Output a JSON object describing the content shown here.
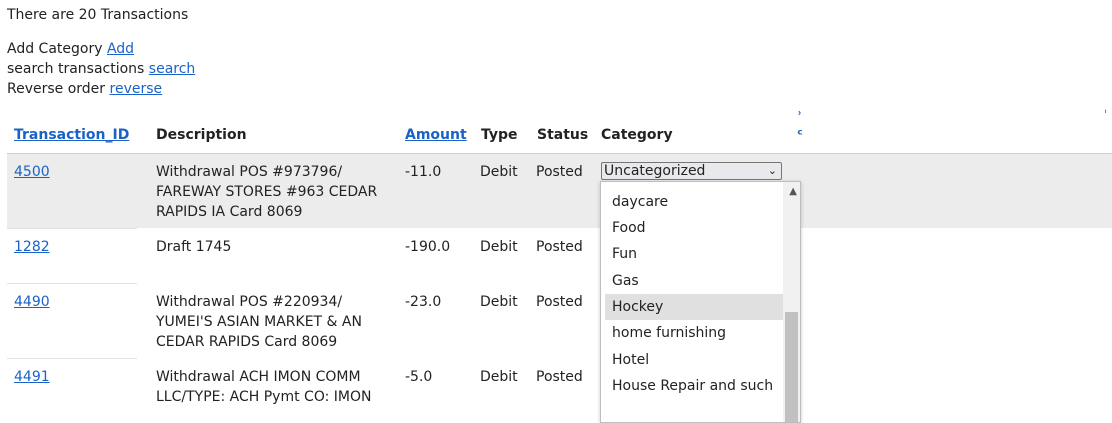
{
  "summary": "There are 20 Transactions",
  "actions": [
    {
      "label": "Add Category",
      "link": "Add"
    },
    {
      "label": "search transactions",
      "link": "search"
    },
    {
      "label": "Reverse order",
      "link": "reverse"
    }
  ],
  "columns": {
    "id": "Transaction_ID",
    "description": "Description",
    "amount": "Amount",
    "type": "Type",
    "status": "Status",
    "category": "Category"
  },
  "rows": [
    {
      "id": "4500",
      "desc1": "Withdrawal POS #973796/",
      "desc2": "FAREWAY STORES #963 CEDAR",
      "desc3": "RAPIDS IA Card 8069",
      "amount": "-11.0",
      "type": "Debit",
      "status": "Posted"
    },
    {
      "id": "1282",
      "desc1": "Draft 1745",
      "desc2": "",
      "desc3": "",
      "amount": "-190.0",
      "type": "Debit",
      "status": "Posted"
    },
    {
      "id": "4490",
      "desc1": "Withdrawal POS #220934/",
      "desc2": "YUMEI'S ASIAN MARKET & AN",
      "desc3": "CEDAR RAPIDS Card 8069",
      "amount": "-23.0",
      "type": "Debit",
      "status": "Posted"
    },
    {
      "id": "4491",
      "desc1": "Withdrawal ACH IMON COMM",
      "desc2": "LLC/TYPE: ACH Pymt CO: IMON",
      "desc3": "",
      "amount": "-5.0",
      "type": "Debit",
      "status": "Posted"
    }
  ],
  "category_select": {
    "selected": "Uncategorized",
    "options": [
      "daycare",
      "Food",
      "Fun",
      "Gas",
      "Hockey",
      "home furnishing",
      "Hotel",
      "House Repair and such"
    ],
    "highlighted": "Hockey"
  }
}
